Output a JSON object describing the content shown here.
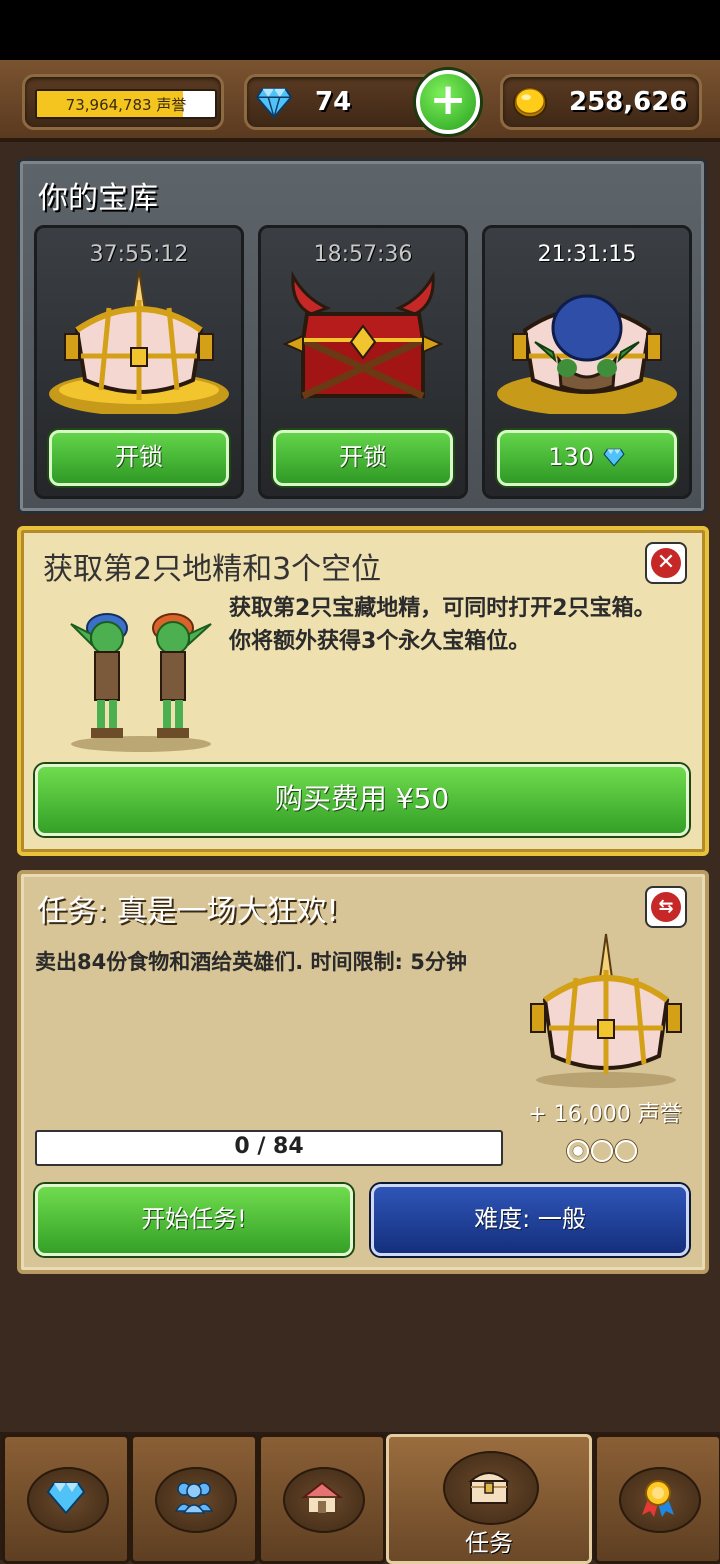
{
  "topbar": {
    "reputation_text": "73,964,783 声誉",
    "reputation_progress": 0.82,
    "gems": "74",
    "coins": "258,626",
    "gem_icon": "diamond-icon",
    "coin_icon": "coin-icon",
    "add_icon": "plus-icon"
  },
  "vault": {
    "title": "你的宝库",
    "chests": [
      {
        "timer": "37:55:12",
        "button": "开锁",
        "type": "unicorn-chest"
      },
      {
        "timer": "18:57:36",
        "button": "开锁",
        "type": "demon-chest"
      },
      {
        "timer": "21:31:15",
        "button": "130",
        "button_icon": "diamond-icon",
        "type": "unicorn-chest-with-goblin"
      }
    ]
  },
  "offer": {
    "title": "获取第2只地精和3个空位",
    "description": "获取第2只宝藏地精，可同时打开2只宝箱。你将额外获得3个永久宝箱位。",
    "button": "购买费用 ¥50"
  },
  "quest": {
    "title": "任务: 真是一场大狂欢!",
    "description": "卖出84份食物和酒给英雄们. 时间限制: 5分钟",
    "reward": "+ 16,000 声誉",
    "progress_text": "0 / 84",
    "progress_value": 0,
    "difficulty_dots": [
      true,
      false,
      false
    ],
    "start_button": "开始任务!",
    "difficulty_button": "难度: 一般"
  },
  "nav": {
    "tabs": [
      {
        "icon": "diamond-icon"
      },
      {
        "icon": "people-icon"
      },
      {
        "icon": "house-icon"
      },
      {
        "icon": "chest-icon",
        "label": "任务",
        "active": true
      },
      {
        "icon": "medal-icon"
      }
    ]
  },
  "colors": {
    "green_button": "#34a027",
    "blue_button": "#142f7c",
    "panel_offer": "#efe0b0",
    "panel_quest": "#d8c597",
    "vault_stone": "#4a5056"
  }
}
